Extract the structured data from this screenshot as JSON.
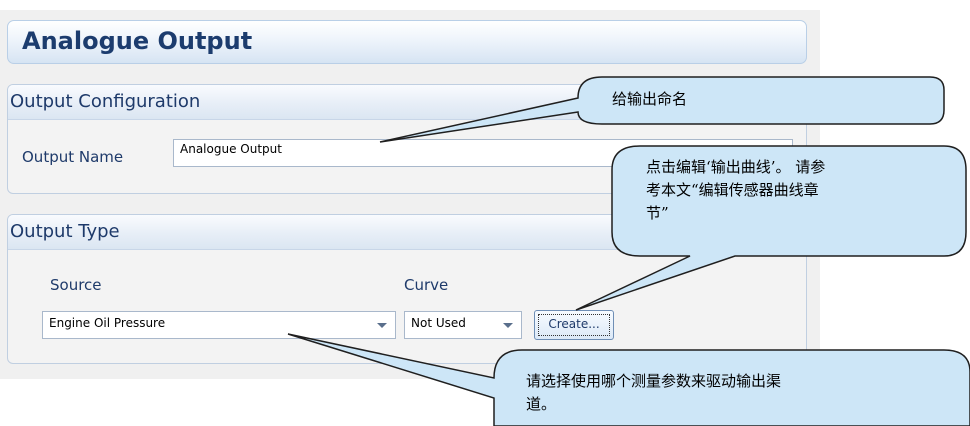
{
  "panel": {
    "title": "Analogue Output"
  },
  "output_configuration": {
    "title": "Output Configuration",
    "name_label": "Output Name",
    "name_value": "Analogue Output"
  },
  "output_type": {
    "title": "Output Type",
    "source_label": "Source",
    "source_value": "Engine Oil Pressure",
    "curve_label": "Curve",
    "curve_value": "Not Used",
    "create_button": "Create..."
  },
  "callouts": {
    "name_hint": "给输出命名",
    "curve_hint_line1": "点击编辑‘输出曲线’。 请参",
    "curve_hint_line2": "考本文“编辑传感器曲线章",
    "curve_hint_line3": "节”",
    "source_hint_line1": "请选择使用哪个测量参数来驱动输出渠",
    "source_hint_line2": "道。"
  },
  "colors": {
    "title_text": "#1c3c6e",
    "group_title": "#1e3a6a",
    "callout_fill": "#cde6f7",
    "callout_border": "#1f1f1f"
  }
}
